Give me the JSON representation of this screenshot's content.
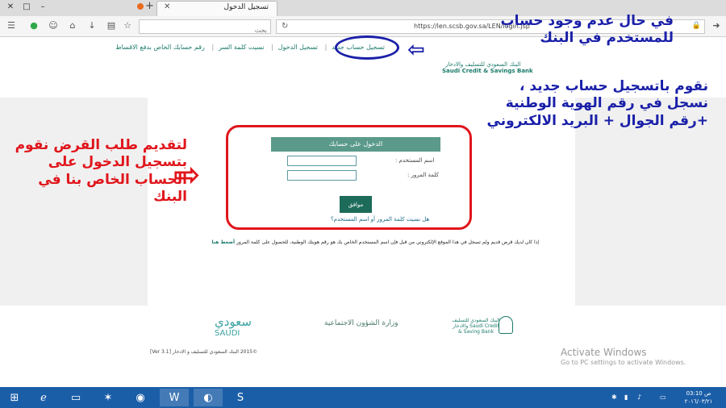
{
  "browser": {
    "tab_title": "تسجيل الدخول",
    "new_tab": "+",
    "url": "https://len.scsb.gov.sa/LEN/login.jsp",
    "search_placeholder": "بحث",
    "window_minimize": "–",
    "window_maximize": "□",
    "window_close": "✕"
  },
  "page": {
    "top_links": [
      "تسجيل حساب جديد",
      "تسجيل الدخول",
      "نسيت كلمة السر",
      "رقم حسابك الخاص بدفع الاقساط"
    ],
    "bank_name_ar": "البنك السعودي للتسليف والادخار",
    "bank_name_en": "Saudi Credit & Savings Bank",
    "login": {
      "title": "الدخول على حسابك",
      "username_label": "اسم المستخدم :",
      "password_label": "كلمة المرور :",
      "submit": "موافق",
      "forgot": "هل نسيت كلمة المرور أو اسم المستخدم؟"
    },
    "note": {
      "text": "إذا كان لديك قرض قديم ولم تسجل في هذا الموقع الإلكتروني من قبل فإن اسم المستخدم الخاص بك هو رقم هويتك الوطنية، للحصول على كلمة المرور",
      "link": "أضغط هنا"
    },
    "footer": {
      "saudi_ar": "سعودي",
      "saudi_en": "SAUDI",
      "vision": "وزارة الشؤون الاجتماعية",
      "bank_small": "البنك السعودي للتسليف والادخار Saudi Credit & Saving Bank",
      "copyright": "©2015 البنك السعودي للتسليف و الادخار [Ver 3.1]"
    }
  },
  "annotations": {
    "blue_top": "في حال عدم وجود حساب للمستخدم في البنك",
    "blue_mid": "نقوم باتسجيل حساب جديد ، نسجل في رقم الهوية الوطنية +رقم الجوال + البريد الالكتروني",
    "red_left": "لتقديم طلب القرض نقوم بتسجيل الدخول على الحساب الخاص بنا في البنك",
    "red_arrow": "⇨",
    "blue_arrow": "⇦"
  },
  "watermark": {
    "line1": "Activate Windows",
    "line2": "Go to PC settings to activate Windows."
  },
  "taskbar": {
    "time": "03:10 ص",
    "date": "٢٠١٦/٠٣/٢١"
  },
  "colors": {
    "accent": "#1b7a6a",
    "annotation_blue": "#1a20a8",
    "annotation_red": "#e0151b",
    "taskbar": "#1b5ea8"
  }
}
